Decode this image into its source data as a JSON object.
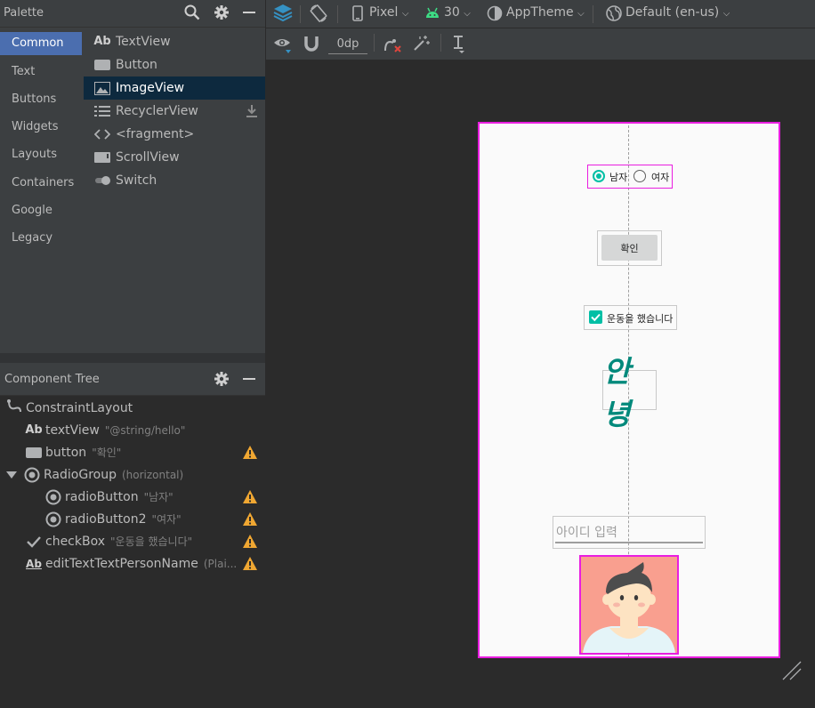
{
  "palette": {
    "title": "Palette",
    "categories": [
      "Common",
      "Text",
      "Buttons",
      "Widgets",
      "Layouts",
      "Containers",
      "Google",
      "Legacy"
    ],
    "selected_category": "Common",
    "items": [
      {
        "label": "TextView",
        "icon": "textview-icon"
      },
      {
        "label": "Button",
        "icon": "button-icon"
      },
      {
        "label": "ImageView",
        "icon": "imageview-icon"
      },
      {
        "label": "RecyclerView",
        "icon": "recyclerview-icon"
      },
      {
        "label": "<fragment>",
        "icon": "fragment-icon"
      },
      {
        "label": "ScrollView",
        "icon": "scrollview-icon"
      },
      {
        "label": "Switch",
        "icon": "switch-icon"
      }
    ],
    "selected_item": "ImageView"
  },
  "component_tree": {
    "title": "Component Tree",
    "nodes": [
      {
        "label": "ConstraintLayout",
        "sub": "",
        "icon": "constraintlayout-icon",
        "warning": false
      },
      {
        "label": "textView",
        "sub": "\"@string/hello\"",
        "icon": "textview-icon",
        "warning": false
      },
      {
        "label": "button",
        "sub": "\"확인\"",
        "icon": "button-icon",
        "warning": true
      },
      {
        "label": "RadioGroup",
        "sub": "(horizontal)",
        "icon": "radiogroup-icon",
        "warning": false
      },
      {
        "label": "radioButton",
        "sub": "\"남자\"",
        "icon": "radiobutton-icon",
        "warning": true
      },
      {
        "label": "radioButton2",
        "sub": "\"여자\"",
        "icon": "radiobutton-icon",
        "warning": true
      },
      {
        "label": "checkBox",
        "sub": "\"운동을 했습니다\"",
        "icon": "checkbox-icon",
        "warning": true
      },
      {
        "label": "editTextTextPersonName",
        "sub": "(Plai...",
        "icon": "edittext-icon",
        "warning": true
      }
    ]
  },
  "toolbar": {
    "device": "Pixel",
    "api": "30",
    "theme": "AppTheme",
    "locale": "Default (en-us)",
    "margin": "0dp"
  },
  "preview": {
    "radio_male": "남자",
    "radio_female": "여자",
    "radio_selected": "남자",
    "button_label": "확인",
    "checkbox_label": "운동을 했습니다",
    "checkbox_checked": true,
    "hello_text": "안녕",
    "edit_placeholder": "아이디 입력"
  },
  "colors": {
    "accent": "#4b6eaf",
    "selection_outline": "#e91ee0",
    "teal": "#00bfa5",
    "warning": "#f0a732"
  }
}
